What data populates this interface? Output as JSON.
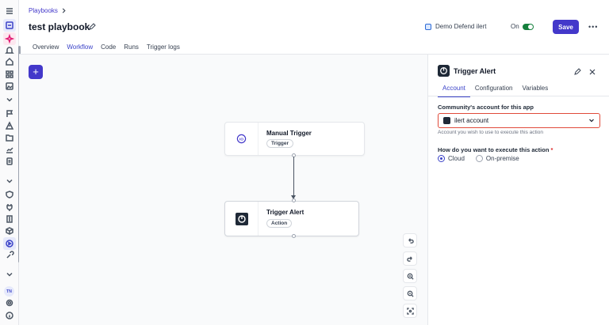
{
  "header": {
    "breadcrumb": "Playbooks",
    "title": "test playbook",
    "app_name": "Demo Defend ilert",
    "toggle_label": "On",
    "toggle_on": true,
    "save_label": "Save"
  },
  "tabs": [
    {
      "label": "Overview",
      "active": false
    },
    {
      "label": "Workflow",
      "active": true
    },
    {
      "label": "Code",
      "active": false
    },
    {
      "label": "Runs",
      "active": false
    },
    {
      "label": "Trigger logs",
      "active": false
    }
  ],
  "canvas": {
    "add_button": "+",
    "nodes": [
      {
        "title": "Manual Trigger",
        "badge": "Trigger"
      },
      {
        "title": "Trigger Alert",
        "badge": "Action"
      }
    ]
  },
  "panel": {
    "title": "Trigger Alert",
    "tabs": [
      {
        "label": "Account",
        "active": true
      },
      {
        "label": "Configuration",
        "active": false
      },
      {
        "label": "Variables",
        "active": false
      }
    ],
    "account_label": "Community's account for this app",
    "account_value": "ilert account",
    "account_help": "Account you wish to use to execute this action",
    "exec_label": "How do you want to execute this action",
    "required_mark": "*",
    "exec_options": [
      {
        "label": "Cloud",
        "selected": true
      },
      {
        "label": "On-premise",
        "selected": false
      }
    ]
  },
  "rail": {
    "avatar_initials": "TN"
  },
  "colors": {
    "accent": "#4338ca",
    "toggle": "#15803d",
    "error_border": "#e04a3a"
  }
}
